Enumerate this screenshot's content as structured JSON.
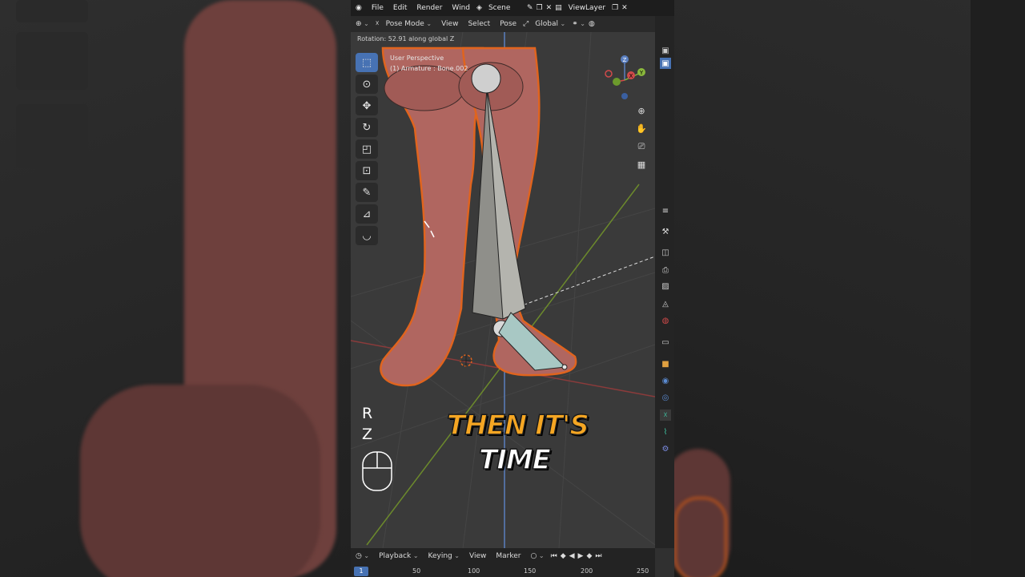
{
  "topbar": {
    "menus": [
      "File",
      "Edit",
      "Render",
      "Wind"
    ],
    "scene": "Scene",
    "view_layer": "ViewLayer"
  },
  "header": {
    "mode": "Pose Mode",
    "menus": [
      "View",
      "Select",
      "Pose"
    ],
    "orientation": "Global"
  },
  "viewport": {
    "status": "Rotation: 52.91 along global Z",
    "perspective": "User Perspective",
    "object": "(1) Armature : Bone.002",
    "gizmo_axes": [
      "Z",
      "Y",
      "X"
    ],
    "key_hint": [
      "R",
      "Z"
    ]
  },
  "caption": {
    "line1": "THEN IT'S",
    "line2": "TIME"
  },
  "timeline": {
    "menus": [
      "Playback",
      "Keying",
      "View",
      "Marker"
    ],
    "current_frame": "1",
    "frame_labels": [
      "50",
      "100",
      "150",
      "200",
      "250"
    ]
  },
  "colors": {
    "accent": "#4772b3",
    "caption_highlight": "#f5a623",
    "skin": "#b56a63",
    "outline": "#e0641e"
  }
}
